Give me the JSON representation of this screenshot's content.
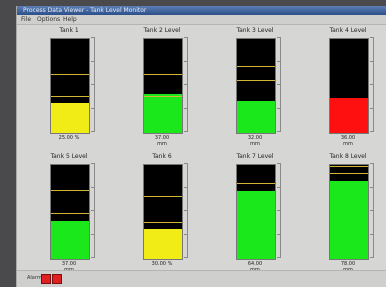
{
  "window": {
    "title": "Process Data Viewer - Tank Level Monitor",
    "menu": [
      "File",
      "Options",
      "Help"
    ]
  },
  "colors": {
    "bar_background": "#000000",
    "limit_line": "#d2b534",
    "yellow": "#f2ec16",
    "green": "#1be81b",
    "red": "#ff1010"
  },
  "panels": [
    {
      "title": "Tank 1",
      "level": 0.32,
      "color": "#f2ec16",
      "limits": [
        0.62,
        0.38
      ],
      "value": "25.00 %",
      "unit": ""
    },
    {
      "title": "Tank 2 Level",
      "level": 0.42,
      "color": "#1be81b",
      "limits": [
        0.62,
        0.38
      ],
      "value": "37.00",
      "unit": "mm"
    },
    {
      "title": "Tank 3 Level",
      "level": 0.34,
      "color": "#1be81b",
      "limits": [
        0.7,
        0.55
      ],
      "value": "32.00",
      "unit": "mm"
    },
    {
      "title": "Tank 4 Level",
      "level": 0.37,
      "color": "#ff1010",
      "limits": [],
      "value": "36.00",
      "unit": "mm"
    },
    {
      "title": "Tank 5 Level",
      "level": 0.4,
      "color": "#1be81b",
      "limits": [
        0.72,
        0.48
      ],
      "value": "37.00",
      "unit": "mm"
    },
    {
      "title": "Tank 6",
      "level": 0.32,
      "color": "#f2ec16",
      "limits": [
        0.66,
        0.38
      ],
      "value": "30.00 %",
      "unit": ""
    },
    {
      "title": "Tank 7 Level",
      "level": 0.72,
      "color": "#1be81b",
      "limits": [
        0.8
      ],
      "value": "64.00",
      "unit": "mm"
    },
    {
      "title": "Tank 8 Level",
      "level": 0.83,
      "color": "#1be81b",
      "limits": [
        0.98,
        0.9
      ],
      "value": "78.00",
      "unit": "mm"
    }
  ],
  "status": {
    "label": "Alarm"
  }
}
